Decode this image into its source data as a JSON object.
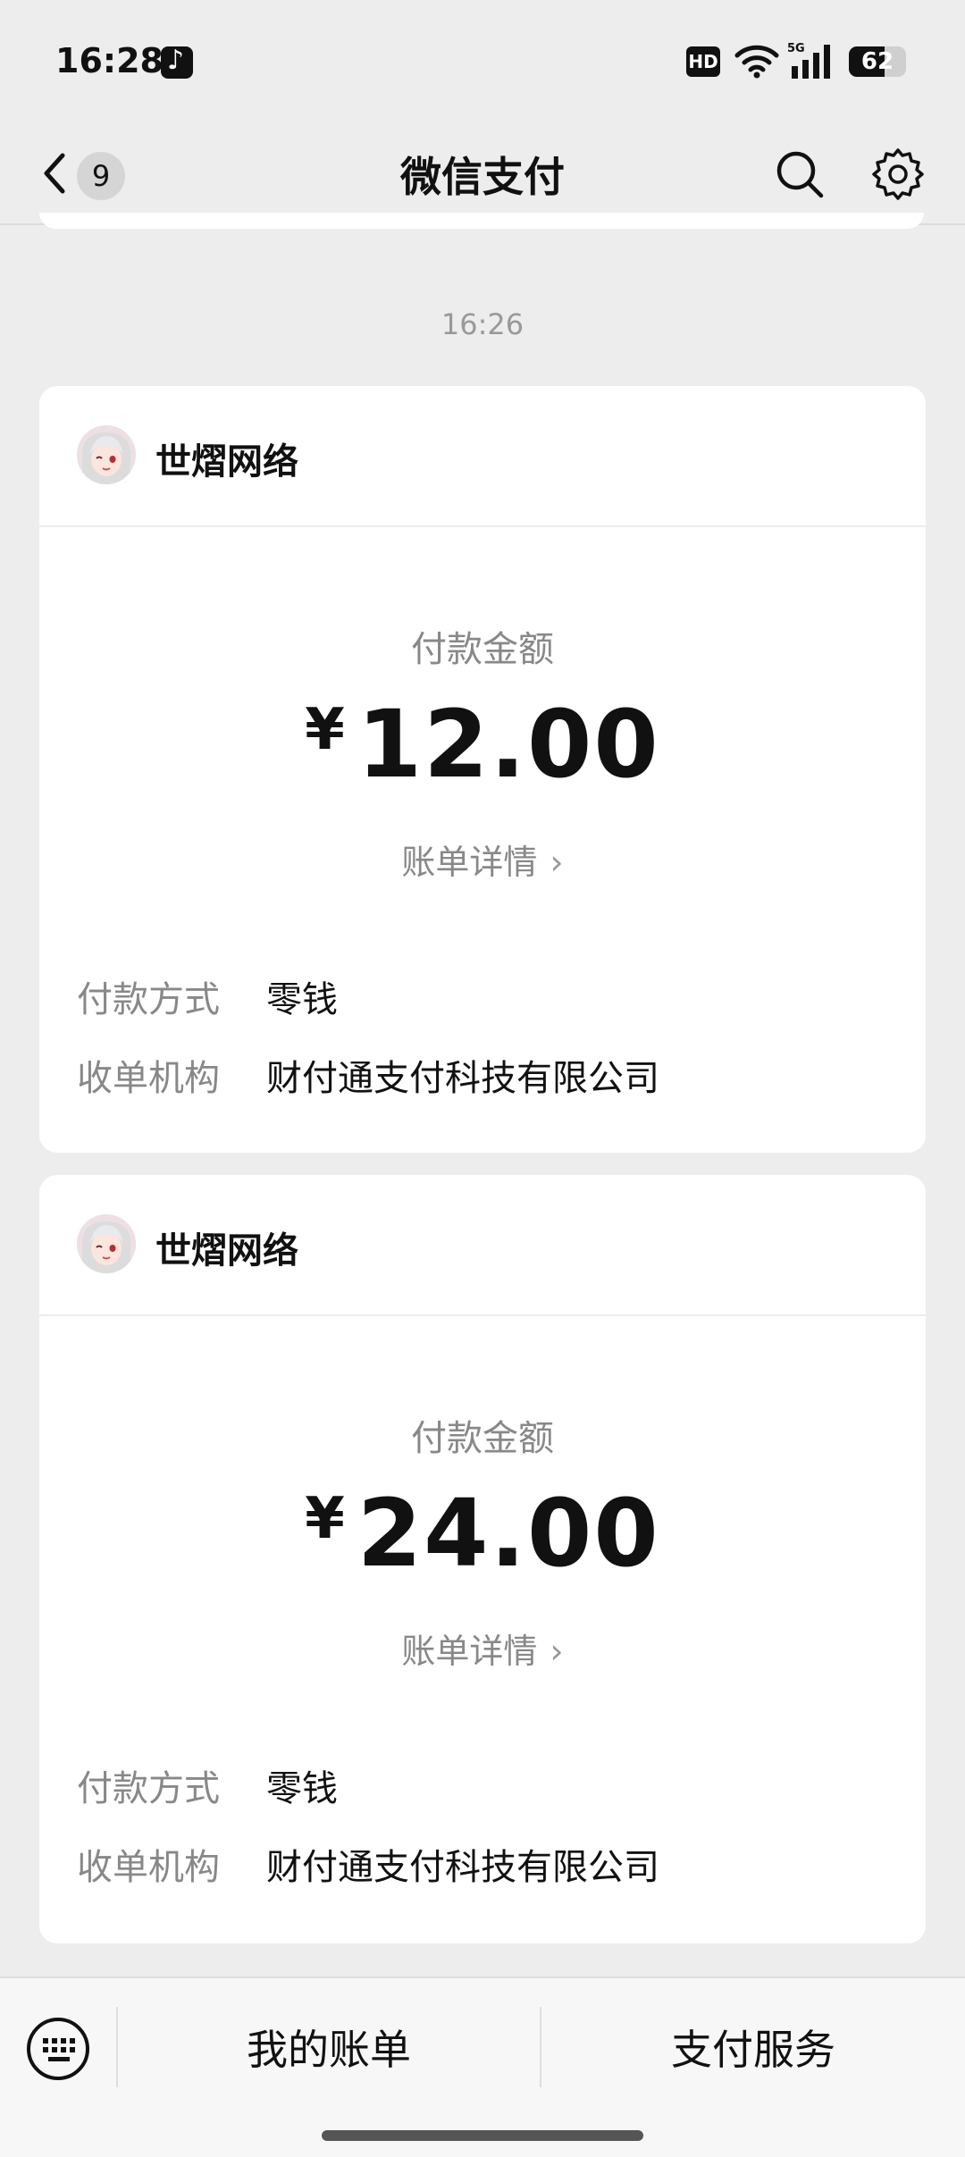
{
  "status_bar": {
    "time": "16:28",
    "hd_label": "HD",
    "network_label": "5G",
    "battery_level": "62",
    "battery_fraction": 0.62
  },
  "navbar": {
    "back_badge": "9",
    "title": "微信支付"
  },
  "chat": {
    "timestamp": "16:26"
  },
  "cards": [
    {
      "merchant": "世熠网络",
      "amount_label": "付款金额",
      "currency": "¥",
      "amount": "12.00",
      "bill_link": "账单详情",
      "details": [
        {
          "label": "付款方式",
          "value": "零钱"
        },
        {
          "label": "收单机构",
          "value": "财付通支付科技有限公司"
        }
      ]
    },
    {
      "merchant": "世熠网络",
      "amount_label": "付款金额",
      "currency": "¥",
      "amount": "24.00",
      "bill_link": "账单详情",
      "details": [
        {
          "label": "付款方式",
          "value": "零钱"
        },
        {
          "label": "收单机构",
          "value": "财付通支付科技有限公司"
        }
      ]
    }
  ],
  "bottom_bar": {
    "my_bills": "我的账单",
    "payment_services": "支付服务"
  },
  "icons": {
    "back": "chevron-left-icon",
    "search": "search-icon",
    "settings": "gear-icon",
    "keyboard": "keyboard-icon"
  }
}
